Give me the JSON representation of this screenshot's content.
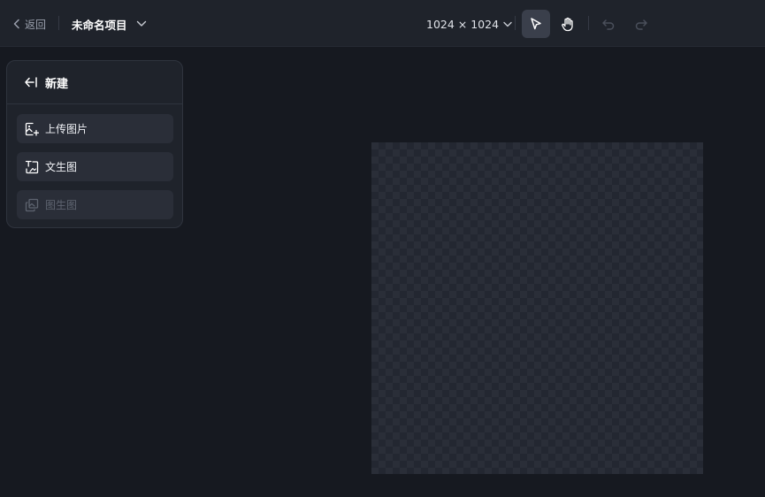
{
  "topbar": {
    "back_label": "返回",
    "project_name": "未命名项目",
    "canvas_size": "1024 × 1024",
    "tools": [
      {
        "name": "select-tool",
        "icon": "cursor-arrow-icon",
        "active": true
      },
      {
        "name": "pan-tool",
        "icon": "hand-icon",
        "active": false
      },
      {
        "name": "undo",
        "icon": "undo-icon",
        "enabled": false
      },
      {
        "name": "redo",
        "icon": "redo-icon",
        "enabled": false
      }
    ]
  },
  "panel": {
    "title": "新建",
    "items": [
      {
        "label": "上传图片",
        "icon": "image-upload-icon",
        "enabled": true
      },
      {
        "label": "文生图",
        "icon": "text-to-image-icon",
        "enabled": true
      },
      {
        "label": "图生图",
        "icon": "image-to-image-icon",
        "enabled": false
      }
    ]
  },
  "colors": {
    "background": "#161920",
    "topbar": "#1f232b",
    "panel": "#1f232b",
    "menu_item": "#2a2e38",
    "active_tool": "#3a3f4b",
    "text": "#ffffff",
    "muted_text": "#9aa0ad",
    "disabled_text": "#5e6470"
  }
}
